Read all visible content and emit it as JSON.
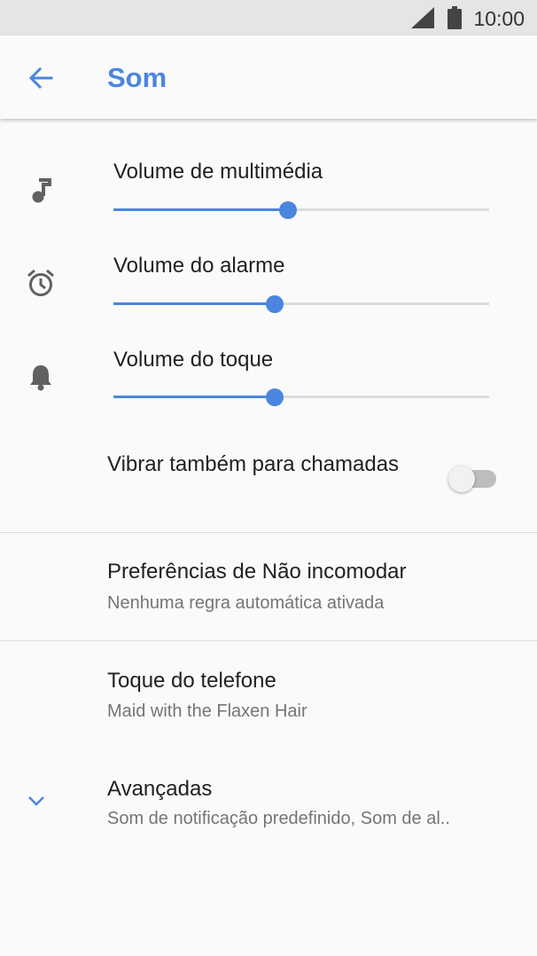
{
  "status_bar": {
    "time": "10:00",
    "signal_icon": "cell-signal-icon",
    "battery_icon": "battery-icon"
  },
  "app_bar": {
    "title": "Som",
    "back_icon": "arrow-back-icon"
  },
  "volumes": [
    {
      "label": "Volume de multimédia",
      "icon": "music-note-icon",
      "level": 0.465
    },
    {
      "label": "Volume do alarme",
      "icon": "alarm-clock-icon",
      "level": 0.43
    },
    {
      "label": "Volume do toque",
      "icon": "bell-icon",
      "level": 0.43
    }
  ],
  "vibrate": {
    "title": "Vibrar também para chamadas",
    "enabled": false
  },
  "dnd": {
    "title": "Preferências de Não incomodar",
    "summary": "Nenhuma regra automática ativada"
  },
  "ringtone": {
    "title": "Toque do telefone",
    "summary": "Maid with the Flaxen Hair"
  },
  "advanced": {
    "title": "Avançadas",
    "summary": "Som de notificação predefinido, Som de al..",
    "icon": "chevron-down-icon"
  },
  "colors": {
    "accent": "#4a86e0",
    "track": "#dcdcdc",
    "status_bar": "#e5e5e5",
    "background": "#fafafa"
  }
}
